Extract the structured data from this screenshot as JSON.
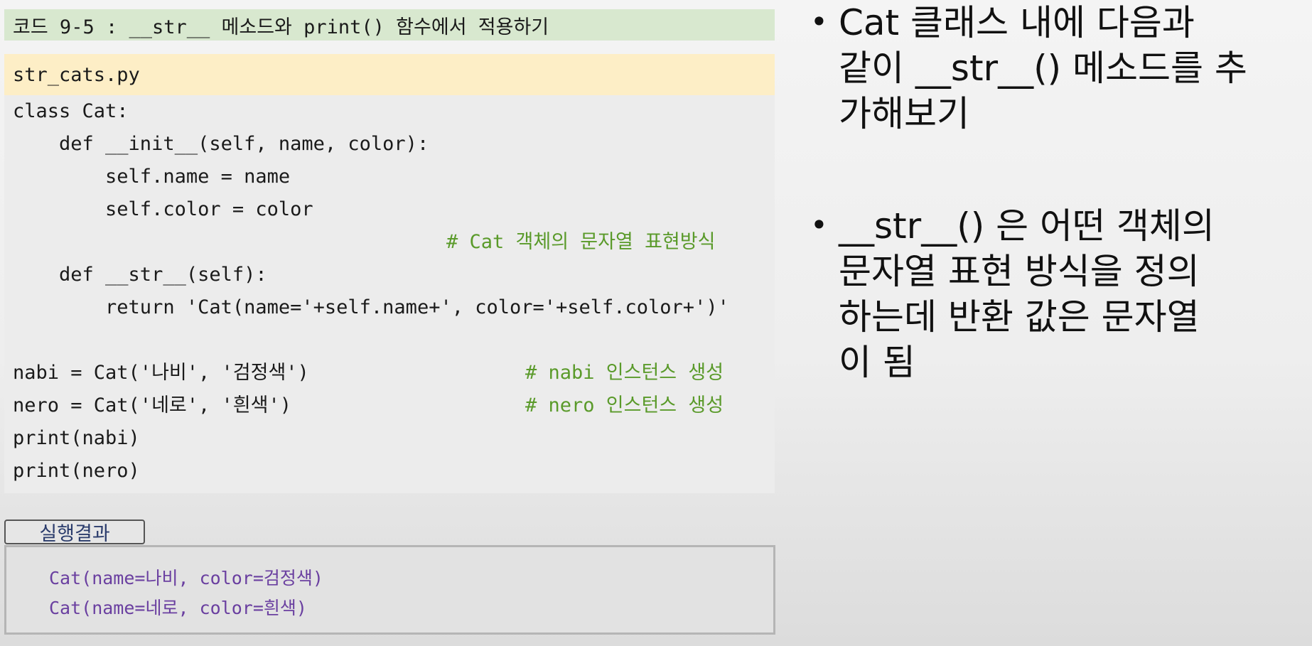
{
  "code_title": "코드 9-5 : __str__ 메소드와 print() 함수에서 적용하기",
  "filename": "str_cats.py",
  "code_lines": [
    "class Cat:",
    "    def __init__(self, name, color):",
    "        self.name = name",
    "        self.color = color",
    "",
    "    def __str__(self):",
    "        return 'Cat(name='+self.name+', color='+self.color+')'",
    "",
    "nabi = Cat('나비', '검정색')",
    "nero = Cat('네로', '흰색')",
    "print(nabi)",
    "print(nero)"
  ],
  "comments": {
    "repr_comment": "# Cat 객체의 문자열 표현방식",
    "nabi_comment": "# nabi 인스턴스 생성",
    "nero_comment": "# nero 인스턴스 생성"
  },
  "result": {
    "tab_label": "실행결과",
    "lines": [
      "Cat(name=나비, color=검정색)",
      "Cat(name=네로, color=흰색)"
    ]
  },
  "bullets": [
    {
      "dot": "•",
      "lines": [
        "Cat 클래스 내에 다음과",
        "같이 __str__() 메소드를 추",
        "가해보기"
      ]
    },
    {
      "dot": "•",
      "lines": [
        "__str__() 은 어떤 객체의",
        "문자열 표현 방식을 정의",
        "하는데 반환 값은 문자열",
        "이 됨"
      ]
    }
  ],
  "colors": {
    "title_bg": "#d8e8cf",
    "file_bg": "#fdeec6",
    "code_bg": "#ececec",
    "comment": "#5a9a2a",
    "result_text": "#6a3fa0",
    "tab_text": "#2b3c6c"
  }
}
